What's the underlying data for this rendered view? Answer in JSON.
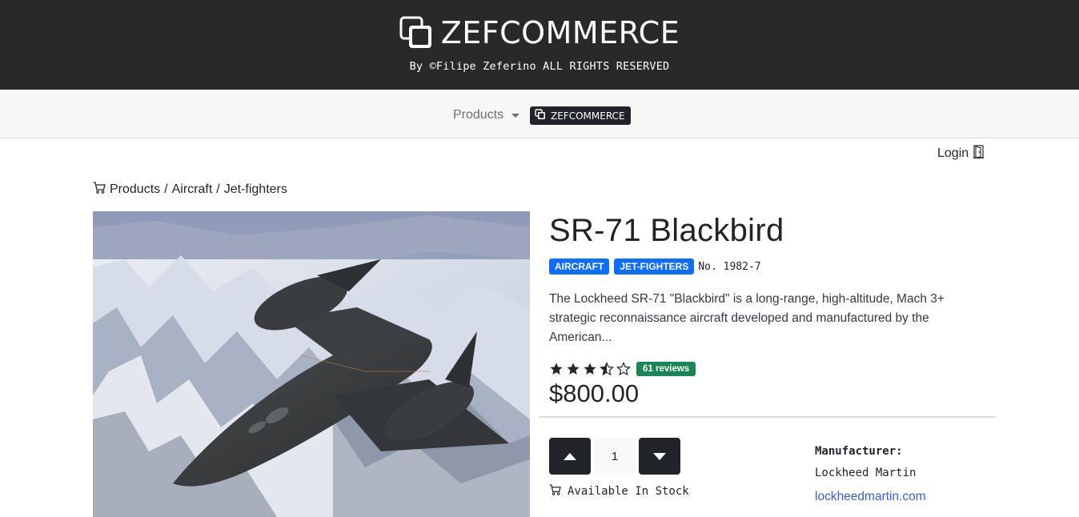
{
  "header": {
    "brand_title": "ZEFCOMMERCE",
    "brand_subtitle": "By ©Filipe Zeferino ALL RIGHTS RESERVED"
  },
  "navbar": {
    "products_label": "Products",
    "brand_button_label": "ZEFCOMMERCE"
  },
  "auth": {
    "login_label": "Login"
  },
  "breadcrumb": {
    "items": [
      "Products",
      "Aircraft",
      "Jet-fighters"
    ],
    "separator": "/"
  },
  "product": {
    "image_icon": "jet-aircraft-photo",
    "title": "SR-71 Blackbird",
    "tags": [
      "AIRCRAFT",
      "JET-FIGHTERS"
    ],
    "sku": "No. 1982-7",
    "description": "The Lockheed SR-71 \"Blackbird\" is a long-range, high-altitude, Mach 3+ strategic reconnaissance aircraft developed and manufactured by the American...",
    "rating": 3.5,
    "rating_max": 5,
    "reviews_label": "61 reviews",
    "price": "$800.00",
    "quantity": "1",
    "stock_label": "Available In Stock",
    "manufacturer_label": "Manufacturer:",
    "manufacturer_name": "Lockheed Martin",
    "manufacturer_link": "lockheedmartin.com"
  },
  "colors": {
    "header_bg": "#2b2829",
    "badge_blue": "#0d6efd",
    "badge_green": "#198754",
    "link": "#3b5bdb",
    "dark_button": "#212529"
  }
}
